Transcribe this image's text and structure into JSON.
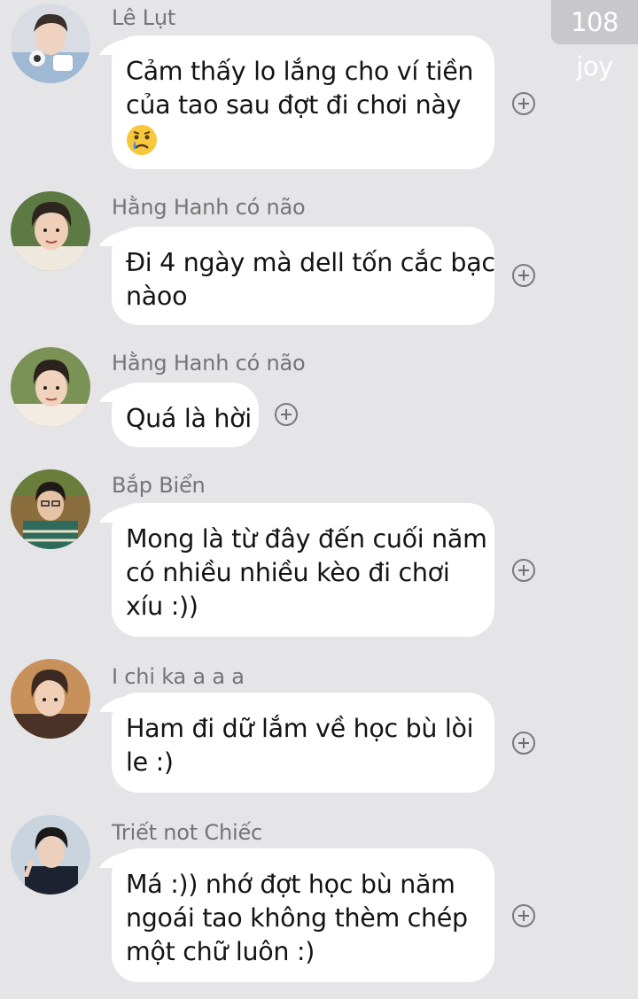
{
  "joy_badge": {
    "count": "108",
    "label": "joy"
  },
  "messages": [
    {
      "sender": "Lê Lụt",
      "lines": [
        "Cảm thấy lo lắng cho ví tiền",
        "của tao sau đợt đi chơi này"
      ],
      "emoji": "crying-face-emoji"
    },
    {
      "sender": "Hằng Hanh có não",
      "lines": [
        "Đi 4 ngày mà dell tốn cắc bạc",
        "nàoo"
      ]
    },
    {
      "sender": "Hằng Hanh có não",
      "lines": [
        "Quá là hời"
      ]
    },
    {
      "sender": "Bắp Biển",
      "lines": [
        "Mong là từ đây đến cuối năm",
        "có nhiều nhiều kèo đi chơi",
        "xíu :))"
      ]
    },
    {
      "sender": "I chi ka a a a",
      "lines": [
        "Ham đi dữ lắm về học bù lòi",
        "le :)"
      ]
    },
    {
      "sender": "Triết not Chiếc",
      "lines": [
        "Má :)) nhớ đợt học bù năm",
        "ngoái tao không thèm chép",
        "một chữ luôn :)"
      ]
    }
  ],
  "colors": {
    "background": "#e5e5e8",
    "bubble": "#ffffff",
    "sender_text": "#757575",
    "badge": "#c8c8cc"
  },
  "icons": {
    "reaction": "add-reaction-icon",
    "emoji": "crying-face-emoji"
  }
}
